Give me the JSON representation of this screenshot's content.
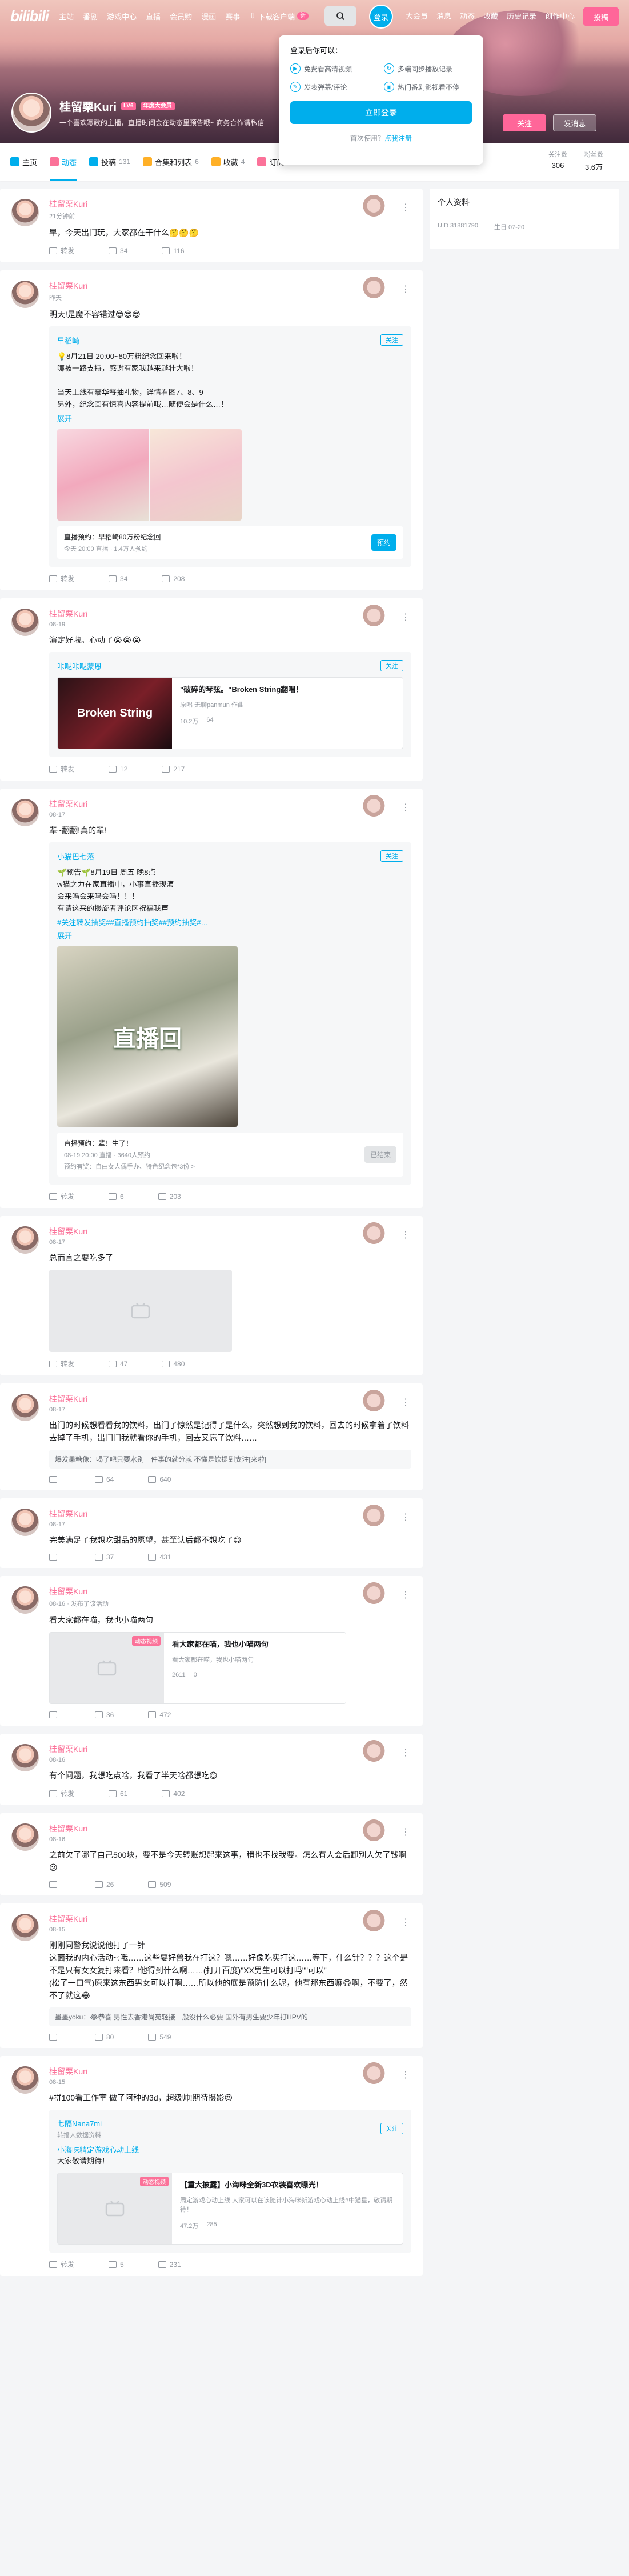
{
  "header": {
    "logo": "bilibili",
    "nav": [
      "主站",
      "番剧",
      "游戏中心",
      "直播",
      "会员购",
      "漫画",
      "赛事"
    ],
    "download": "下载客户端",
    "download_badge": "新",
    "login": "登录",
    "right_nav": [
      "大会员",
      "消息",
      "动态",
      "收藏",
      "历史记录",
      "创作中心"
    ],
    "upload": "投稿"
  },
  "login_popup": {
    "title": "登录后你可以：",
    "items": [
      "免费看高清视频",
      "多端同步播放记录",
      "发表弹幕/评论",
      "热门番剧影视看不停"
    ],
    "button": "立即登录",
    "footer_prefix": "首次使用？",
    "footer_link": "点我注册"
  },
  "profile": {
    "name": "桂留栗Kuri",
    "level": "LV6",
    "vip": "年度大会员",
    "sign": "一个喜欢写歌的主播，直播时间会在动态里预告哦~ 商务合作请私信",
    "follow": "关注",
    "message": "发消息"
  },
  "tabs": [
    {
      "label": "主页",
      "num": "",
      "color": "#00aeec"
    },
    {
      "label": "动态",
      "num": "",
      "color": "#fb7299"
    },
    {
      "label": "投稿",
      "num": "131",
      "color": "#00aeec"
    },
    {
      "label": "合集和列表",
      "num": "6",
      "color": "#ffb027"
    },
    {
      "label": "收藏",
      "num": "4",
      "color": "#ffb027"
    },
    {
      "label": "订阅",
      "num": "",
      "color": "#fb7299"
    }
  ],
  "stats": [
    {
      "label": "关注数",
      "value": "306"
    },
    {
      "label": "粉丝数",
      "value": "3.6万"
    }
  ],
  "sidebar": {
    "title": "个人资料",
    "uid": "UID 31881790",
    "birthday": "生日 07-20"
  },
  "posts": [
    {
      "name": "桂留栗Kuri",
      "time": "21分钟前",
      "text": "早，今天出门玩，大家都在干什么🤔🤔🤔",
      "forward": "转发",
      "comment": "34",
      "like": "116"
    },
    {
      "name": "桂留栗Kuri",
      "time": "昨天",
      "text": "明天!是魔不容错过😎😎😎",
      "repost_name": "早稻崎",
      "repost_follow": "关注",
      "repost_text": "💡8月21日 20:00~80万粉纪念回来啦！\n哪被一路支持，感谢有家我越来越壮大啦！\n\n当天上线有豪华餐抽礼物，详情看图7、8、9\n另外，纪念回有惊喜内容提前哦…随便会是什么…！",
      "expand": "展开",
      "live_title": "直播预约：早稻崎80万粉纪念回",
      "live_sub": "今天 20:00 直播 · 1.4万人预约",
      "live_btn": "预约",
      "forward": "转发",
      "comment": "34",
      "like": "208"
    },
    {
      "name": "桂留栗Kuri",
      "time": "08-19",
      "text": "演定好啦。心动了😭😭😭",
      "repost_name": "咔哒咔哒蒙恩",
      "repost_follow": "关注",
      "video_title": "\"破碎的琴弦。\"Broken String翻唱！",
      "video_up": "原唱 无聊panmun 作曲",
      "video_play": "10.2万",
      "video_dm": "64",
      "thumb_text": "Broken String",
      "forward": "转发",
      "comment": "12",
      "like": "217"
    },
    {
      "name": "桂留栗Kuri",
      "time": "08-17",
      "text": "辈~翻翻!真的辈!",
      "repost_name": "小猫巴七落",
      "repost_follow": "关注",
      "repost_text": "🌱预告🌱8月19日 周五 晚8点\nw猫之力在家直播中，小事直播现演\n会来吗会来吗会吗！！！\n有请这来的援旋者评论区祝福我声",
      "repost_tags": "#关注转发抽奖##直播预约抽奖##预约抽奖#…",
      "expand": "展开",
      "cover_text": "直播回",
      "live_title": "直播预约：辈！生了！",
      "live_sub": "08-19 20:00 直播 · 3640人预约",
      "live_note": "预约有奖：自由女人偶手办、特色纪念包*3份 >",
      "live_btn": "已结束",
      "forward": "转发",
      "comment": "6",
      "like": "203"
    },
    {
      "name": "桂留栗Kuri",
      "time": "08-17",
      "text": "总而言之要吃多了",
      "forward": "转发",
      "comment": "47",
      "like": "480"
    },
    {
      "name": "桂留栗Kuri",
      "time": "08-17",
      "text": "出门的时候想看看我的饮料，出门了惊然是记得了是什么，突然想到我的饮料，回去的时候拿着了饮料去掉了手机，出门门我就看你的手机，回去又忘了饮料……",
      "comment_user": "爆发果糖像",
      "comment_text": "喝了吧只要水别一件事的就分就 不懂是饮提到支注[来啦]",
      "forward": "",
      "comment": "64",
      "like": "640"
    },
    {
      "name": "桂留栗Kuri",
      "time": "08-17",
      "text": "完美满足了我想吃甜品的愿望，甚至认后都不想吃了😋",
      "forward": "",
      "comment": "37",
      "like": "431"
    },
    {
      "name": "桂留栗Kuri",
      "time": "08-16 · 发布了该活动",
      "text": "看大家都在喵，我也小喵两句",
      "video_title": "看大家都在喵，我也小喵两句",
      "video_desc": "看大家都在喵，我也小喵两句",
      "video_tag": "动态视频",
      "video_play": "2611",
      "video_dm": "0",
      "forward": "",
      "comment": "36",
      "like": "472"
    },
    {
      "name": "桂留栗Kuri",
      "time": "08-16",
      "text": "有个问题，我想吃点啥，我看了半天啥都想吃😋",
      "forward": "转发",
      "comment": "61",
      "like": "402"
    },
    {
      "name": "桂留栗Kuri",
      "time": "08-16",
      "text": "之前欠了哪了自己500块，要不是今天转账想起来这事，稍也不找我要。怎么有人会后卸别人欠了钱啊😕",
      "forward": "",
      "comment": "26",
      "like": "509"
    },
    {
      "name": "桂留栗Kuri",
      "time": "08-15",
      "text": "刚刚同警我说说他打了一针\n这面我的内心活动~:哦……这些要好兽我在打这？嗯……好像吃实打这……等下，什么针？？？这个是不是只有女女复打来看？!他得到什么啊……(打开百度)\"XX男生可以打吗\"\"可以\"\n(松了一口气)原来这东西男女可以打啊……所以他的底是预防什么呢，他有那东西嘛😂啊，不要了，然不了就这😂",
      "comment_user": "墨墨yoku",
      "comment_text": "😂恭喜 男性去香港尚苑轻接一般没什么必要 国外有男生要少年打HPV的",
      "forward": "",
      "comment": "80",
      "like": "549"
    },
    {
      "name": "桂留栗Kuri",
      "time": "08-15",
      "text": "#拼100看工作室 做了阿种的3d，超级帅!期待摄影😍",
      "repost_name": "七隔Nana7mi",
      "repost_time": "转播人数据资料",
      "repost_link": "小海味精定游戏心动上线",
      "repost_text": "大家敬请期待！",
      "video_title": "【重大披露】小海咪全新3D衣装喜欢曝光！",
      "video_desc": "周定游戏心动上线 大家可以在该随计小海咪新游戏心动上线#中猫星，敬请期待！",
      "video_tag": "动态视频",
      "video_play": "47.2万",
      "video_dm": "285",
      "forward": "转发",
      "comment": "5",
      "like": "231"
    }
  ]
}
